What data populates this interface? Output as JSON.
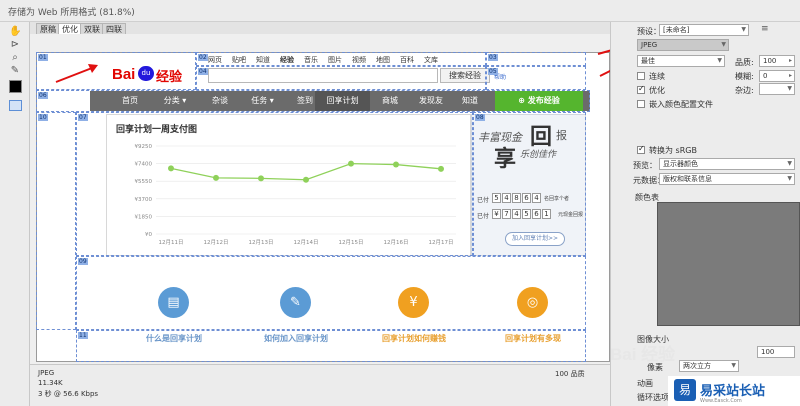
{
  "window": {
    "title": "存储为 Web 所用格式 (81.8%)"
  },
  "tabs": [
    {
      "label": "原稿"
    },
    {
      "label": "优化"
    },
    {
      "label": "双联"
    },
    {
      "label": "四联"
    }
  ],
  "baidu": {
    "logo_bai": "Bai",
    "logo_paw": "du",
    "logo_jingyan": "经验",
    "topnav": [
      "网页",
      "贴吧",
      "知道",
      "经验",
      "音乐",
      "图片",
      "视频",
      "地图",
      "百科",
      "文库"
    ],
    "search_button": "搜索经验",
    "help_link": "帮助",
    "nav": [
      "首页",
      "分类 ▾",
      "杂谈",
      "任务 ▾",
      "签到",
      "回享计划",
      "商城",
      "发现友",
      "知道"
    ],
    "publish_button": "发布经验"
  },
  "chart_data": {
    "type": "line",
    "title": "回享计划一周支付图",
    "categories": [
      "12月11日",
      "12月12日",
      "12月13日",
      "12月14日",
      "12月15日",
      "12月16日",
      "12月17日"
    ],
    "series": [
      {
        "values": [
          6900,
          5900,
          5850,
          5700,
          7400,
          7300,
          6850
        ]
      }
    ],
    "ytick_labels": [
      "¥0",
      "¥1850",
      "¥3700",
      "¥5550",
      "¥7400",
      "¥9250"
    ],
    "ylim": [
      0,
      9250
    ],
    "color": "#8fd15a",
    "grid": true
  },
  "promo": {
    "slogan_line1": "丰富现金",
    "slogan_big1": "回",
    "slogan_line2": "报",
    "slogan_big2": "享",
    "slogan_line3": "乐创佳作",
    "row1_label": "已付",
    "row1_digits": [
      "5",
      "4",
      "8",
      "6",
      "4"
    ],
    "row1_suffix": "名回享个者",
    "row2_label": "已付",
    "row2_digits": [
      "¥",
      "7",
      "4",
      "5",
      "6",
      "1"
    ],
    "row2_suffix": "元现金回报",
    "button": "加入回享计划>>"
  },
  "features": [
    {
      "label": "什么是回享计划",
      "color": "#5b9bd5",
      "label_color": "#6a96c9",
      "icon": "book-icon"
    },
    {
      "label": "如何加入回享计划",
      "color": "#5b9bd5",
      "label_color": "#6a96c9",
      "icon": "edit-icon"
    },
    {
      "label": "回享计划如何赚钱",
      "color": "#f0a020",
      "label_color": "#e8a030",
      "icon": "money-bag-icon"
    },
    {
      "label": "回享计划有多现",
      "color": "#f0a020",
      "label_color": "#e8a030",
      "icon": "coin-icon"
    }
  ],
  "slices": [
    "01",
    "02",
    "03",
    "04",
    "05",
    "06",
    "07",
    "08",
    "09",
    "10",
    "11"
  ],
  "status": {
    "format": "JPEG",
    "size": "11.34K",
    "time": "3 秒 @ 56.6 Kbps",
    "quality_right": "100 品质"
  },
  "panel": {
    "preset_label": "预设：",
    "preset_value": "[未命名]",
    "format_value": "JPEG",
    "quality_preset": "最佳",
    "quality_label": "品质:",
    "quality_value": "100",
    "progressive_label": "连续",
    "blur_label": "模糊:",
    "blur_value": "0",
    "optimized_label": "优化",
    "matte_label": "杂边:",
    "embed_label": "嵌入颜色配置文件",
    "convert_label": "转换为 sRGB",
    "preview_label": "预览：",
    "preview_value": "显示器颜色",
    "metadata_label": "元数据：",
    "metadata_value": "版权和联系信息",
    "colortable_label": "颜色表",
    "image_size_label": "图像大小",
    "size_value": "100",
    "size_unit": "像素",
    "quality_dropdown": "两次立方",
    "anim_label": "动画",
    "loop_label": "循环选项"
  },
  "watermark": {
    "baidu_text": "Bai 经验",
    "site_text": "易采站长站",
    "site_sub": "Www.Easck.Com",
    "logo_char": "易"
  }
}
